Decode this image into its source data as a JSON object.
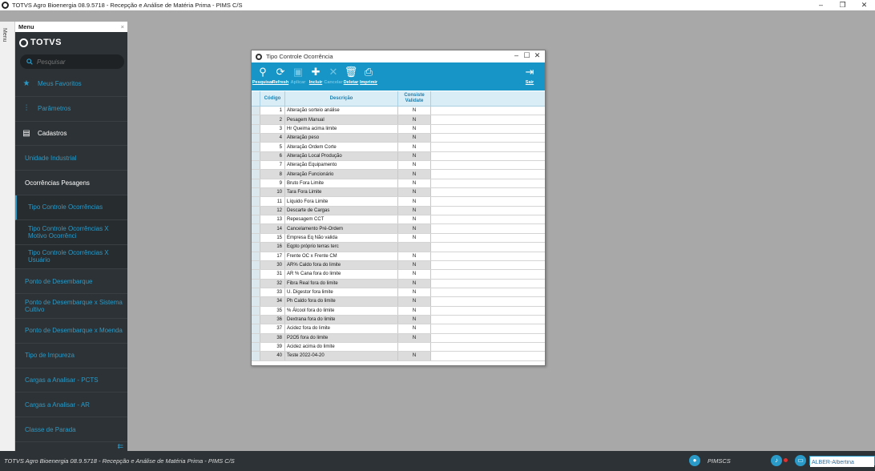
{
  "window": {
    "title": "TOTVS Agro Bioenergia 08.9.5718 - Recepção e Análise de Matéria Prima - PIMS C/S"
  },
  "side_strip": {
    "label": "Menu"
  },
  "menu": {
    "header": "Menu",
    "close": "×",
    "brand": "TOTVS",
    "search_placeholder": "Pesquisar",
    "items": [
      {
        "label": "Meus Favoritos"
      },
      {
        "label": "Parâmetros"
      },
      {
        "label": "Cadastros"
      },
      {
        "label": "Unidade Industrial"
      },
      {
        "label": "Ocorrências Pesagens"
      },
      {
        "label": "Tipo Controle Ocorrências"
      },
      {
        "label": "Tipo Controle Ocorrências X Motivo Ocorrênci"
      },
      {
        "label": "Tipo Controle Ocorrências X Usuário"
      },
      {
        "label": "Ponto de Desembarque"
      },
      {
        "label": "Ponto de Desembarque x Sistema Cultivo"
      },
      {
        "label": "Ponto de Desembarque x Moenda"
      },
      {
        "label": "Tipo de Impureza"
      },
      {
        "label": "Cargas a Analisar - PCTS"
      },
      {
        "label": "Cargas a Analisar - AR"
      },
      {
        "label": "Classe de Parada"
      }
    ]
  },
  "dialog": {
    "title": "Tipo Controle Ocorrência",
    "toolbar": {
      "pesquisar": "Pesquisar",
      "refresh": "Refresh",
      "aplicar": "Aplicar",
      "incluir": "Incluir",
      "cancelar": "Cancelar",
      "deletar": "Deletar",
      "imprimir": "Imprimir",
      "sair": "Sair"
    },
    "grid": {
      "headers": {
        "codigo": "Código",
        "descricao": "Descrição",
        "consiste": "Consiste Validate"
      },
      "rows": [
        {
          "codigo": "1",
          "descricao": "Alteração sorteio análise",
          "consiste": "N"
        },
        {
          "codigo": "2",
          "descricao": "Pesagem Manual",
          "consiste": "N"
        },
        {
          "codigo": "3",
          "descricao": "Hr Queima acima limite",
          "consiste": "N"
        },
        {
          "codigo": "4",
          "descricao": "Alteração peso",
          "consiste": "N"
        },
        {
          "codigo": "5",
          "descricao": "Alteração Ordem Corte",
          "consiste": "N"
        },
        {
          "codigo": "6",
          "descricao": "Alteração Local Produção",
          "consiste": "N"
        },
        {
          "codigo": "7",
          "descricao": "Alteração Equipamento",
          "consiste": "N"
        },
        {
          "codigo": "8",
          "descricao": "Alteração Funcionário",
          "consiste": "N"
        },
        {
          "codigo": "9",
          "descricao": "Bruto Fora Limite",
          "consiste": "N"
        },
        {
          "codigo": "10",
          "descricao": "Tara Fora Limite",
          "consiste": "N"
        },
        {
          "codigo": "11",
          "descricao": "Líquido Fora Limite",
          "consiste": "N"
        },
        {
          "codigo": "12",
          "descricao": "Descarte de Cargas",
          "consiste": "N"
        },
        {
          "codigo": "13",
          "descricao": "Repesagem CCT",
          "consiste": "N"
        },
        {
          "codigo": "14",
          "descricao": "Cancelamento Pré-Ordem",
          "consiste": "N"
        },
        {
          "codigo": "15",
          "descricao": "Empresa Eq Não valida",
          "consiste": "N"
        },
        {
          "codigo": "16",
          "descricao": "Eqpto próprio terras terc",
          "consiste": ""
        },
        {
          "codigo": "17",
          "descricao": "Frente OC x Frente CM",
          "consiste": "N"
        },
        {
          "codigo": "30",
          "descricao": "AR% Caldo fora do limite",
          "consiste": "N"
        },
        {
          "codigo": "31",
          "descricao": "AR % Cana fora do limite",
          "consiste": "N"
        },
        {
          "codigo": "32",
          "descricao": "Fibra Real fora do limite",
          "consiste": "N"
        },
        {
          "codigo": "33",
          "descricao": "U. Digestor fora limite",
          "consiste": "N"
        },
        {
          "codigo": "34",
          "descricao": "Ph Caldo fora do limite",
          "consiste": "N"
        },
        {
          "codigo": "35",
          "descricao": "% Álcool fora do limite",
          "consiste": "N"
        },
        {
          "codigo": "36",
          "descricao": "Dextrana fora do limite",
          "consiste": "N"
        },
        {
          "codigo": "37",
          "descricao": "Acidez fora do limite",
          "consiste": "N"
        },
        {
          "codigo": "38",
          "descricao": "P2O5 fora do limite",
          "consiste": "N"
        },
        {
          "codigo": "39",
          "descricao": "Acidez acima do limite",
          "consiste": ""
        },
        {
          "codigo": "40",
          "descricao": "Teste 2022-04-20",
          "consiste": "N"
        }
      ]
    }
  },
  "statusbar": {
    "text": "TOTVS Agro Bioenergia 08.9.5718 - Recepção e Análise de Matéria Prima - PIMS C/S",
    "user": "PIMSCS",
    "environment": "ALBER-Albertina"
  },
  "colors": {
    "accent": "#1795c6",
    "menu_bg": "#2c3235",
    "link": "#2a9ac8"
  }
}
